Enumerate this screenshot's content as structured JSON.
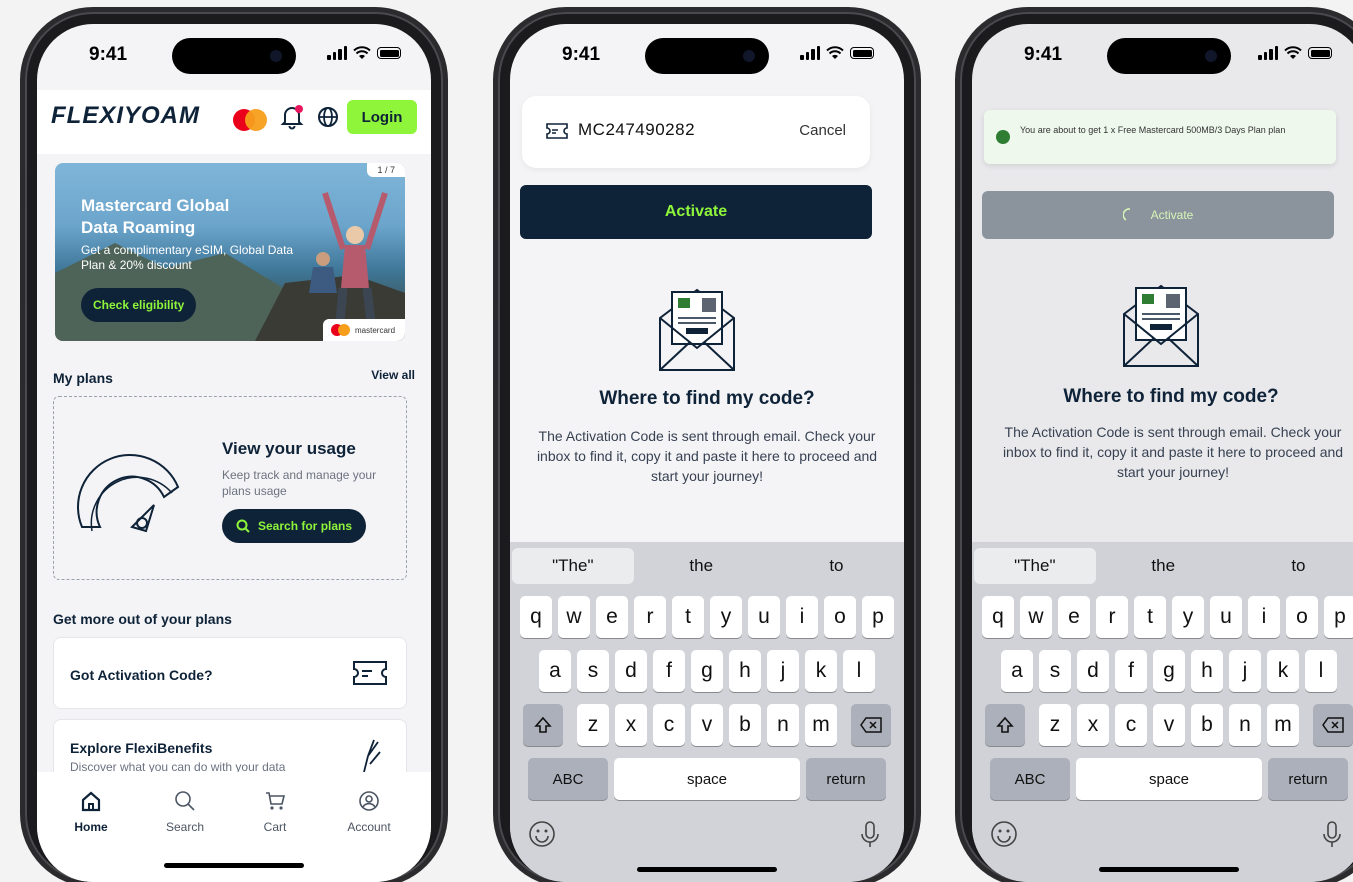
{
  "status": {
    "time": "9:41"
  },
  "phone1": {
    "brand": "FLEXIYOAM",
    "login": "Login",
    "banner": {
      "counter": "1 / 7",
      "title": "Mastercard Global Data Roaming",
      "subtitle": "Get a complimentary eSIM, Global Data Plan & 20% discount",
      "cta": "Check eligibility",
      "badge": "mastercard"
    },
    "my_plans": {
      "title": "My plans",
      "view_all": "View all"
    },
    "usage": {
      "title": "View your usage",
      "subtitle": "Keep track and manage your plans usage",
      "cta": "Search for plans"
    },
    "get_more": {
      "title": "Get more out of your plans"
    },
    "cards": [
      {
        "title": "Got Activation Code?"
      },
      {
        "title": "Explore FlexiBenefits",
        "subtitle": "Discover what you can do with your data"
      }
    ],
    "tabs": [
      {
        "label": "Home",
        "icon": "home-icon"
      },
      {
        "label": "Search",
        "icon": "search-icon"
      },
      {
        "label": "Cart",
        "icon": "cart-icon"
      },
      {
        "label": "Account",
        "icon": "account-icon"
      }
    ]
  },
  "phone2": {
    "code": "MC247490282",
    "cancel": "Cancel",
    "activate": "Activate",
    "find_title": "Where to find my code?",
    "find_text": "The Activation Code is sent through email. Check your inbox to find it, copy it and paste it here to proceed and start your journey!"
  },
  "phone3": {
    "toast": "You are about to get 1 x Free Mastercard 500MB/3 Days Plan plan",
    "activate": "Activate",
    "find_title": "Where to find my code?",
    "find_text": "The Activation Code is sent through email. Check your inbox to find it, copy it and paste it here to proceed and start your journey!"
  },
  "keyboard": {
    "suggestions": [
      "\"The\"",
      "the",
      "to"
    ],
    "row1": [
      "q",
      "w",
      "e",
      "r",
      "t",
      "y",
      "u",
      "i",
      "o",
      "p"
    ],
    "row2": [
      "a",
      "s",
      "d",
      "f",
      "g",
      "h",
      "j",
      "k",
      "l"
    ],
    "row3": [
      "z",
      "x",
      "c",
      "v",
      "b",
      "n",
      "m"
    ],
    "abc": "ABC",
    "space": "space",
    "return": "return"
  },
  "colors": {
    "navy": "#0e2238",
    "lime": "#8ef53a"
  }
}
